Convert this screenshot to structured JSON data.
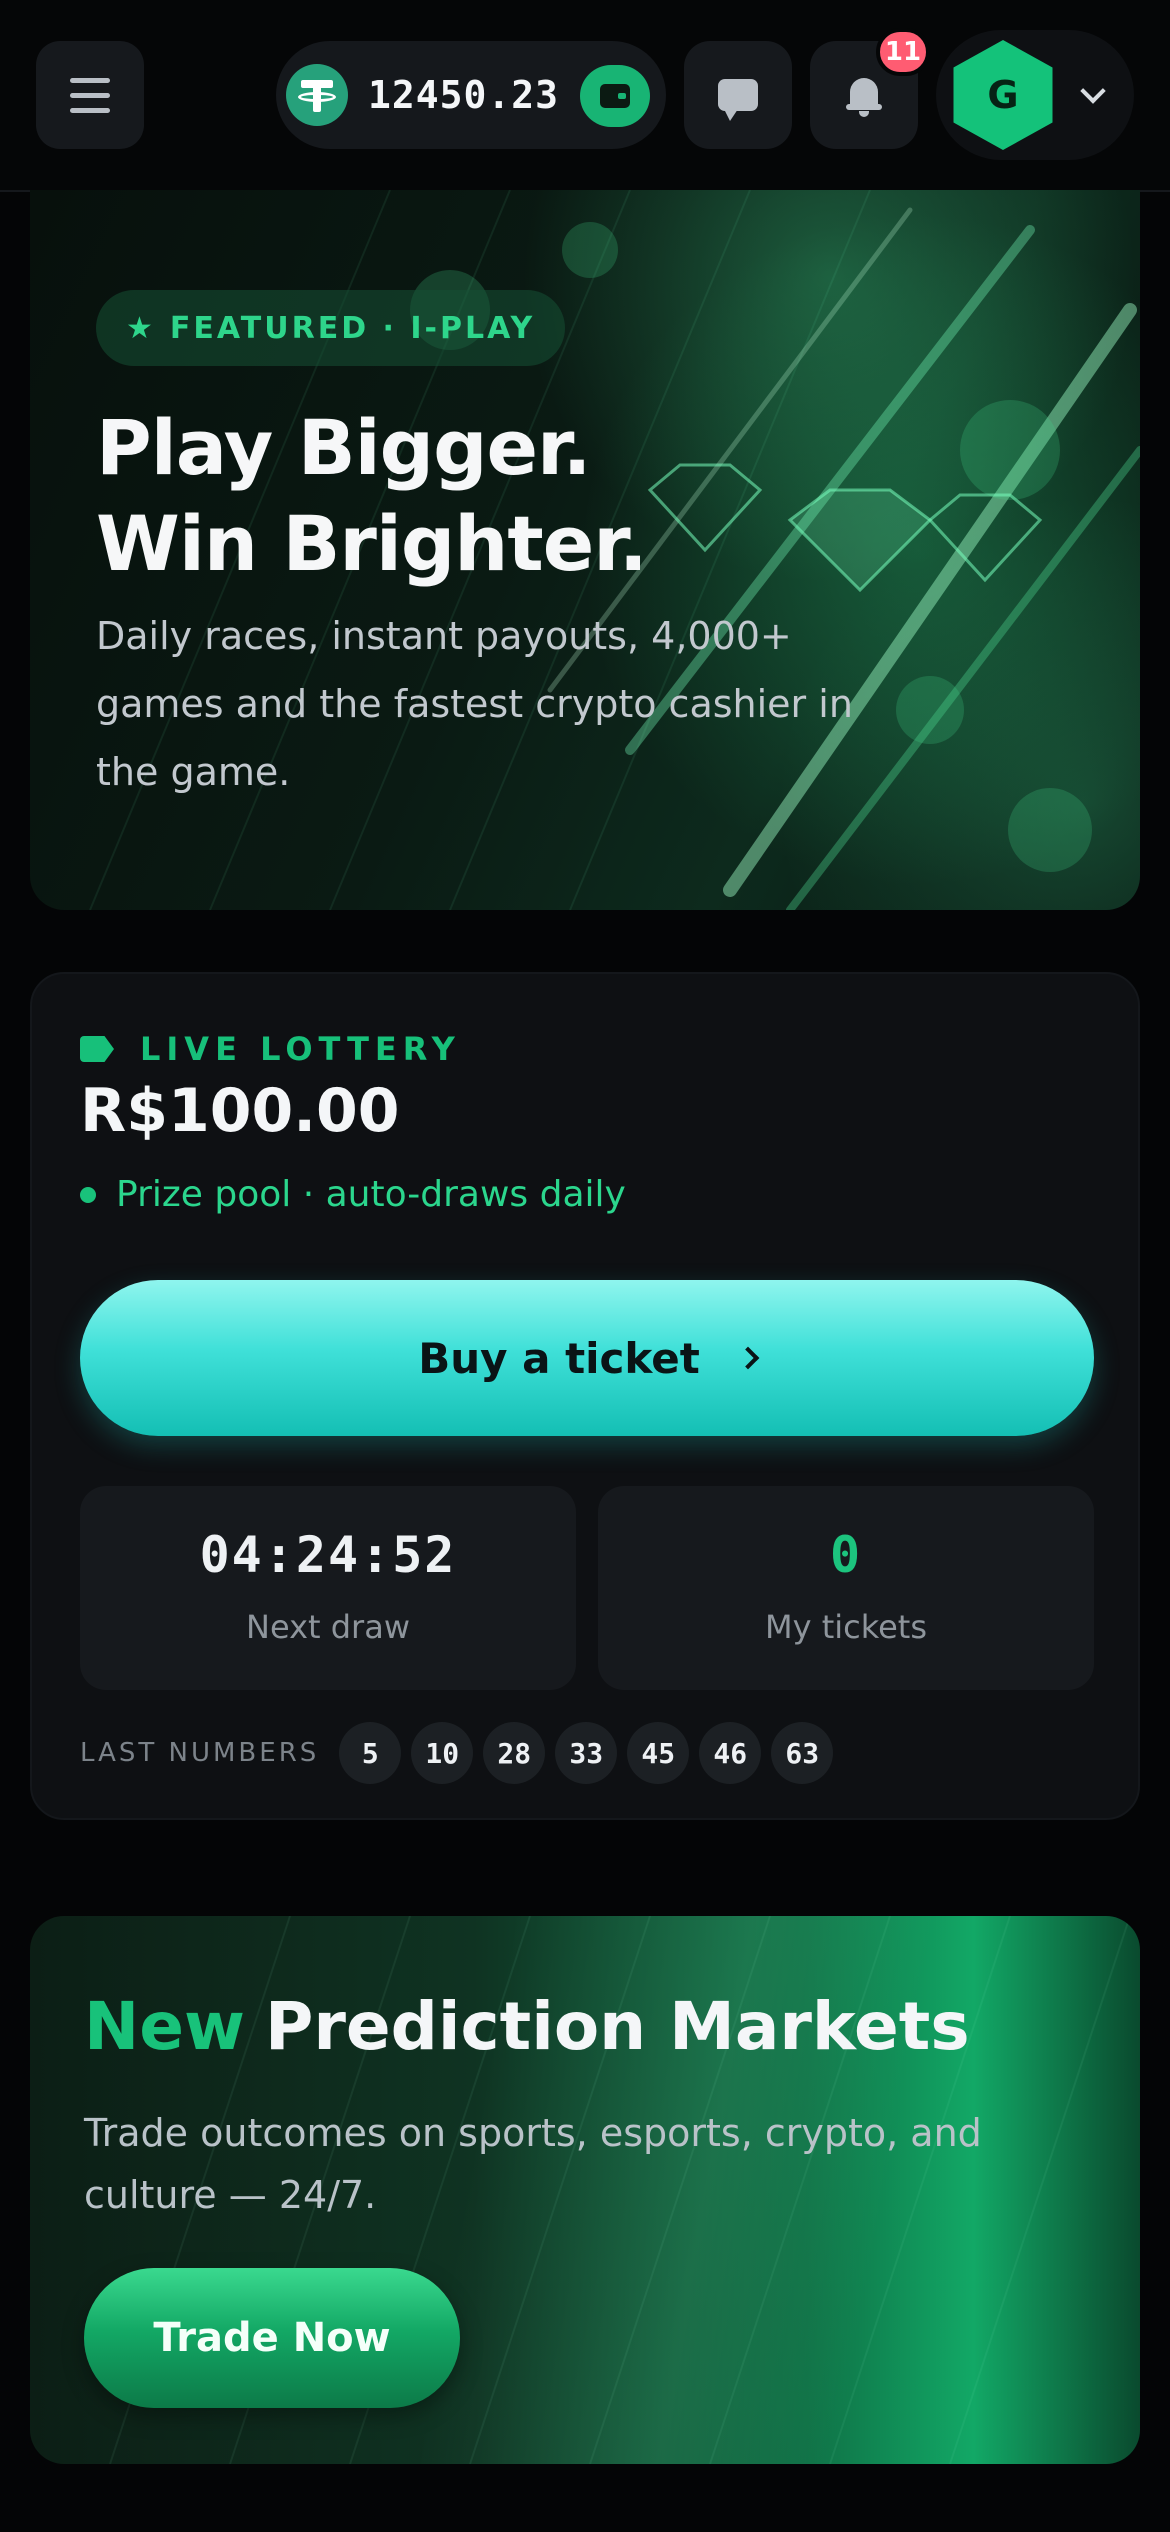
{
  "header": {
    "balance": "12450.23",
    "notification_count": "11",
    "avatar_initial": "G"
  },
  "hero": {
    "badge": "FEATURED · I-PLAY",
    "title_line1": "Play Bigger.",
    "title_line2": "Win Brighter.",
    "description": "Daily races, instant payouts, 4,000+ games and the fastest crypto cashier in the game."
  },
  "lottery": {
    "label": "LIVE LOTTERY",
    "amount": "R$100.00",
    "subtitle": "Prize pool · auto-draws daily",
    "buy_label": "Buy a ticket",
    "next_draw_value": "04:24:52",
    "next_draw_label": "Next draw",
    "my_tickets_value": "0",
    "my_tickets_label": "My tickets",
    "last_numbers_label": "LAST NUMBERS",
    "last_numbers": [
      "5",
      "10",
      "28",
      "33",
      "45",
      "46",
      "63"
    ]
  },
  "prediction": {
    "title_accent": "New",
    "title_rest": "Prediction Markets",
    "description": "Trade outcomes on sports, esports, crypto, and culture — 24/7.",
    "cta": "Trade Now"
  },
  "colors": {
    "brand_green": "#17c07a",
    "cta_cyan": "#3fe0d8",
    "notification_red": "#ff5c72",
    "background": "#040506"
  },
  "icons": [
    "menu-icon",
    "tether-icon",
    "wallet-icon",
    "chat-icon",
    "bell-icon",
    "chevron-down-icon",
    "star-icon",
    "ticket-icon",
    "chevron-right-icon"
  ]
}
